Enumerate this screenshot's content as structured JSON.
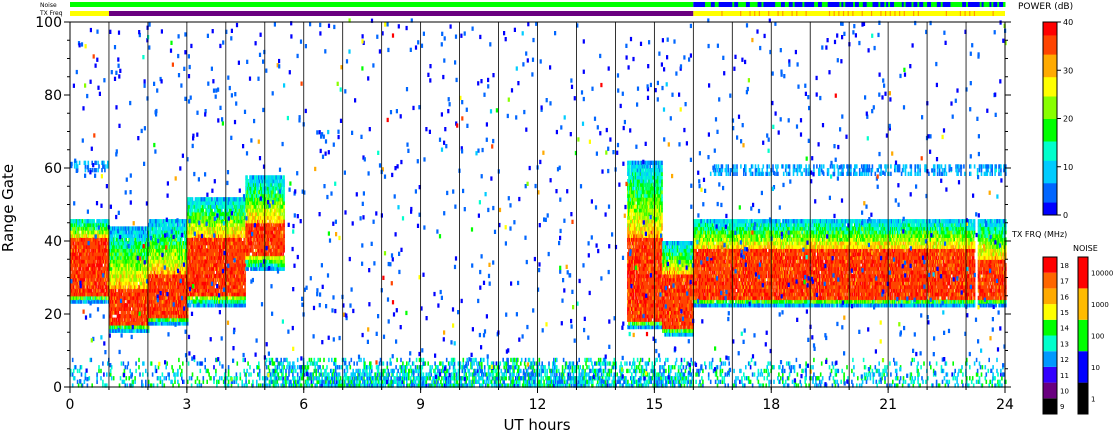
{
  "chart_data": {
    "type": "heatmap",
    "xlabel": "UT hours",
    "ylabel": "Range Gate",
    "xlim": [
      0,
      24
    ],
    "ylim": [
      0,
      100
    ],
    "x_ticks": [
      "0",
      "3",
      "6",
      "9",
      "12",
      "15",
      "18",
      "21",
      "24"
    ],
    "y_ticks": [
      "0",
      "20",
      "40",
      "60",
      "80",
      "100"
    ],
    "x_minor_hours": [
      1,
      2,
      3,
      4,
      5,
      6,
      7,
      8,
      9,
      10,
      11,
      12,
      13,
      14,
      15,
      16,
      17,
      18,
      19,
      20,
      21,
      22,
      23
    ],
    "grid": "vertical lines every hour",
    "top_strips": [
      {
        "label": "Noise",
        "segments": [
          {
            "from": 0,
            "to": 16,
            "level": "100"
          },
          {
            "from": 16,
            "to": 24,
            "level": "mixed 10-100"
          }
        ]
      },
      {
        "label": "TX Freq",
        "segments": [
          {
            "from": 0,
            "to": 1,
            "level": "15"
          },
          {
            "from": 1,
            "to": 16,
            "level": "10"
          },
          {
            "from": 16,
            "to": 24,
            "level": "15"
          }
        ]
      }
    ],
    "power_regions": [
      {
        "from": 0.0,
        "to": 1.0,
        "g_lo": 23,
        "g_hi": 46,
        "core_lo": 25,
        "core_hi": 40
      },
      {
        "from": 1.0,
        "to": 2.0,
        "g_lo": 15,
        "g_hi": 44,
        "core_lo": 17,
        "core_hi": 26
      },
      {
        "from": 2.0,
        "to": 3.0,
        "g_lo": 17,
        "g_hi": 46,
        "core_lo": 19,
        "core_hi": 30
      },
      {
        "from": 3.0,
        "to": 4.5,
        "g_lo": 22,
        "g_hi": 52,
        "core_lo": 25,
        "core_hi": 40
      },
      {
        "from": 4.5,
        "to": 5.5,
        "g_lo": 32,
        "g_hi": 58,
        "core_lo": 36,
        "core_hi": 44
      },
      {
        "from": 14.3,
        "to": 15.2,
        "g_lo": 16,
        "g_hi": 62,
        "core_lo": 18,
        "core_hi": 40
      },
      {
        "from": 15.2,
        "to": 16.0,
        "g_lo": 14,
        "g_hi": 40,
        "core_lo": 16,
        "core_hi": 30
      },
      {
        "from": 16.0,
        "to": 23.2,
        "g_lo": 22,
        "g_hi": 46,
        "core_lo": 24,
        "core_hi": 37
      },
      {
        "from": 23.3,
        "to": 24.0,
        "g_lo": 22,
        "g_hi": 46,
        "core_lo": 24,
        "core_hi": 34
      }
    ],
    "near_ground_band": {
      "from": 0,
      "to": 24,
      "g_lo": 0,
      "g_hi": 8
    },
    "echo_60_band": [
      {
        "from": 0.1,
        "to": 1.0,
        "gate": 60
      },
      {
        "from": 16.4,
        "to": 24.0,
        "gate": 59
      }
    ],
    "power_colorbar": {
      "title": "POWER (dB)",
      "ticks": [
        "0",
        "10",
        "20",
        "30",
        "40"
      ],
      "colors": [
        "#0000ff",
        "#0066ff",
        "#00ccff",
        "#00ffcc",
        "#00ff00",
        "#88ff00",
        "#ffff00",
        "#ffaa00",
        "#ff4400",
        "#ff0000"
      ]
    },
    "txfreq_colorbar": {
      "title": "TX FRQ (MHz)",
      "ticks": [
        "9",
        "10",
        "11",
        "12",
        "13",
        "14",
        "15",
        "16",
        "17",
        "18"
      ],
      "colors": [
        "#000000",
        "#6a0080",
        "#3300ff",
        "#0099ff",
        "#00ffcc",
        "#00ff00",
        "#ffff00",
        "#ffaa00",
        "#ff6600",
        "#ff0000"
      ]
    },
    "noise_colorbar": {
      "title": "NOISE",
      "ticks": [
        "1",
        "10",
        "100",
        "1000",
        "10000"
      ],
      "colors": [
        "#000000",
        "#0000ff",
        "#00ff00",
        "#ffbb00",
        "#ff0000"
      ]
    }
  }
}
